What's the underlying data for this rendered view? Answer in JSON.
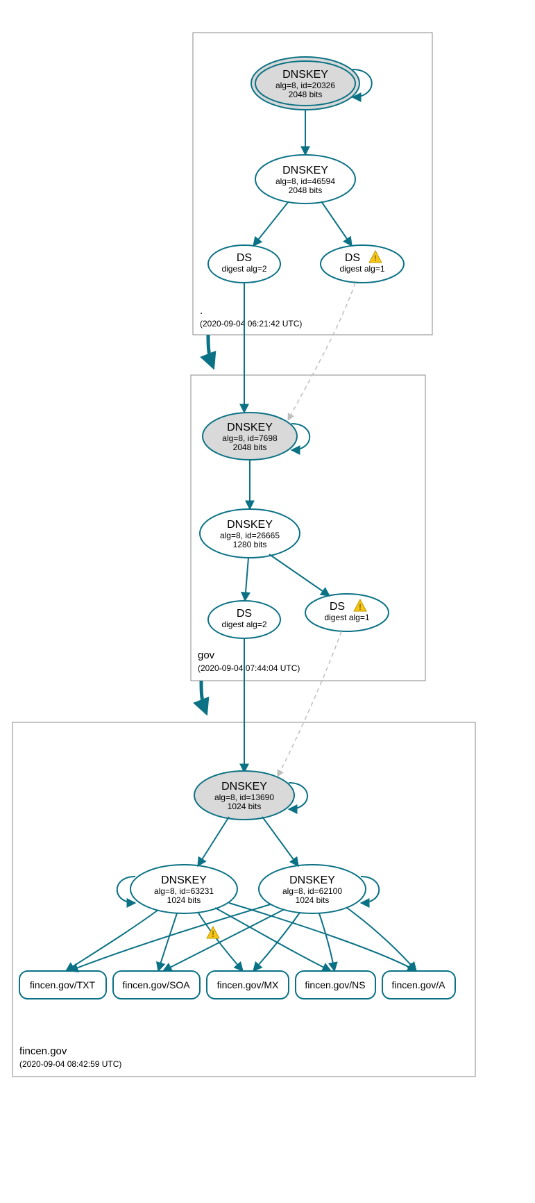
{
  "colors": {
    "accent": "#0b7285",
    "filled": "#d9d9d9",
    "dashed": "#bfbfbf"
  },
  "zones": {
    "root": {
      "label": ".",
      "time": "(2020-09-04 06:21:42 UTC)"
    },
    "gov": {
      "label": "gov",
      "time": "(2020-09-04 07:44:04 UTC)"
    },
    "leaf": {
      "label": "fincen.gov",
      "time": "(2020-09-04 08:42:59 UTC)"
    }
  },
  "nodes": {
    "root_ksk": {
      "title": "DNSKEY",
      "sub1": "alg=8, id=20326",
      "sub2": "2048 bits"
    },
    "root_zsk": {
      "title": "DNSKEY",
      "sub1": "alg=8, id=46594",
      "sub2": "2048 bits"
    },
    "root_ds2": {
      "title": "DS",
      "sub1": "digest alg=2"
    },
    "root_ds1": {
      "title": "DS",
      "sub1": "digest alg=1",
      "warn": true
    },
    "gov_ksk": {
      "title": "DNSKEY",
      "sub1": "alg=8, id=7698",
      "sub2": "2048 bits"
    },
    "gov_zsk": {
      "title": "DNSKEY",
      "sub1": "alg=8, id=26665",
      "sub2": "1280 bits"
    },
    "gov_ds2": {
      "title": "DS",
      "sub1": "digest alg=2"
    },
    "gov_ds1": {
      "title": "DS",
      "sub1": "digest alg=1",
      "warn": true
    },
    "leaf_ksk": {
      "title": "DNSKEY",
      "sub1": "alg=8, id=13690",
      "sub2": "1024 bits"
    },
    "leaf_zsk1": {
      "title": "DNSKEY",
      "sub1": "alg=8, id=63231",
      "sub2": "1024 bits"
    },
    "leaf_zsk2": {
      "title": "DNSKEY",
      "sub1": "alg=8, id=62100",
      "sub2": "1024 bits"
    },
    "rr_txt": {
      "title": "fincen.gov/TXT"
    },
    "rr_soa": {
      "title": "fincen.gov/SOA"
    },
    "rr_mx": {
      "title": "fincen.gov/MX"
    },
    "rr_ns": {
      "title": "fincen.gov/NS"
    },
    "rr_a": {
      "title": "fincen.gov/A"
    }
  },
  "chart_data": {
    "type": "graph",
    "description": "DNSSEC delegation / signing graph",
    "zones": [
      {
        "name": ".",
        "timestamp": "2020-09-04 06:21:42 UTC"
      },
      {
        "name": "gov",
        "timestamp": "2020-09-04 07:44:04 UTC"
      },
      {
        "name": "fincen.gov",
        "timestamp": "2020-09-04 08:42:59 UTC"
      }
    ],
    "nodes": [
      {
        "id": "root_ksk",
        "zone": ".",
        "type": "DNSKEY",
        "alg": 8,
        "key_id": 20326,
        "bits": 2048,
        "trust_anchor": true,
        "self_loop": true
      },
      {
        "id": "root_zsk",
        "zone": ".",
        "type": "DNSKEY",
        "alg": 8,
        "key_id": 46594,
        "bits": 2048
      },
      {
        "id": "root_ds2",
        "zone": ".",
        "type": "DS",
        "digest_alg": 2
      },
      {
        "id": "root_ds1",
        "zone": ".",
        "type": "DS",
        "digest_alg": 1,
        "warning": true
      },
      {
        "id": "gov_ksk",
        "zone": "gov",
        "type": "DNSKEY",
        "alg": 8,
        "key_id": 7698,
        "bits": 2048,
        "self_loop": true
      },
      {
        "id": "gov_zsk",
        "zone": "gov",
        "type": "DNSKEY",
        "alg": 8,
        "key_id": 26665,
        "bits": 1280
      },
      {
        "id": "gov_ds2",
        "zone": "gov",
        "type": "DS",
        "digest_alg": 2
      },
      {
        "id": "gov_ds1",
        "zone": "gov",
        "type": "DS",
        "digest_alg": 1,
        "warning": true
      },
      {
        "id": "leaf_ksk",
        "zone": "fincen.gov",
        "type": "DNSKEY",
        "alg": 8,
        "key_id": 13690,
        "bits": 1024,
        "self_loop": true
      },
      {
        "id": "leaf_zsk1",
        "zone": "fincen.gov",
        "type": "DNSKEY",
        "alg": 8,
        "key_id": 63231,
        "bits": 1024,
        "self_loop": true
      },
      {
        "id": "leaf_zsk2",
        "zone": "fincen.gov",
        "type": "DNSKEY",
        "alg": 8,
        "key_id": 62100,
        "bits": 1024,
        "self_loop": true
      },
      {
        "id": "rr_txt",
        "zone": "fincen.gov",
        "type": "RRset",
        "name": "fincen.gov/TXT"
      },
      {
        "id": "rr_soa",
        "zone": "fincen.gov",
        "type": "RRset",
        "name": "fincen.gov/SOA"
      },
      {
        "id": "rr_mx",
        "zone": "fincen.gov",
        "type": "RRset",
        "name": "fincen.gov/MX"
      },
      {
        "id": "rr_ns",
        "zone": "fincen.gov",
        "type": "RRset",
        "name": "fincen.gov/NS"
      },
      {
        "id": "rr_a",
        "zone": "fincen.gov",
        "type": "RRset",
        "name": "fincen.gov/A"
      }
    ],
    "edges": [
      {
        "from": "root_ksk",
        "to": "root_zsk",
        "style": "solid"
      },
      {
        "from": "root_zsk",
        "to": "root_ds2",
        "style": "solid"
      },
      {
        "from": "root_zsk",
        "to": "root_ds1",
        "style": "solid"
      },
      {
        "from": "root_ds2",
        "to": "gov_ksk",
        "style": "solid"
      },
      {
        "from": "root_ds1",
        "to": "gov_ksk",
        "style": "dashed"
      },
      {
        "from": "zone:.",
        "to": "zone:gov",
        "style": "solid-thick"
      },
      {
        "from": "gov_ksk",
        "to": "gov_zsk",
        "style": "solid"
      },
      {
        "from": "gov_zsk",
        "to": "gov_ds2",
        "style": "solid"
      },
      {
        "from": "gov_zsk",
        "to": "gov_ds1",
        "style": "solid"
      },
      {
        "from": "gov_ds2",
        "to": "leaf_ksk",
        "style": "solid"
      },
      {
        "from": "gov_ds1",
        "to": "leaf_ksk",
        "style": "dashed"
      },
      {
        "from": "zone:gov",
        "to": "zone:fincen.gov",
        "style": "solid-thick"
      },
      {
        "from": "leaf_ksk",
        "to": "leaf_zsk1",
        "style": "solid"
      },
      {
        "from": "leaf_ksk",
        "to": "leaf_zsk2",
        "style": "solid"
      },
      {
        "from": "leaf_zsk1",
        "to": "rr_txt",
        "style": "solid"
      },
      {
        "from": "leaf_zsk1",
        "to": "rr_soa",
        "style": "solid"
      },
      {
        "from": "leaf_zsk1",
        "to": "rr_mx",
        "style": "solid",
        "warning": true
      },
      {
        "from": "leaf_zsk1",
        "to": "rr_ns",
        "style": "solid"
      },
      {
        "from": "leaf_zsk1",
        "to": "rr_a",
        "style": "solid"
      },
      {
        "from": "leaf_zsk2",
        "to": "rr_txt",
        "style": "solid"
      },
      {
        "from": "leaf_zsk2",
        "to": "rr_soa",
        "style": "solid"
      },
      {
        "from": "leaf_zsk2",
        "to": "rr_mx",
        "style": "solid"
      },
      {
        "from": "leaf_zsk2",
        "to": "rr_ns",
        "style": "solid"
      },
      {
        "from": "leaf_zsk2",
        "to": "rr_a",
        "style": "solid"
      }
    ]
  }
}
